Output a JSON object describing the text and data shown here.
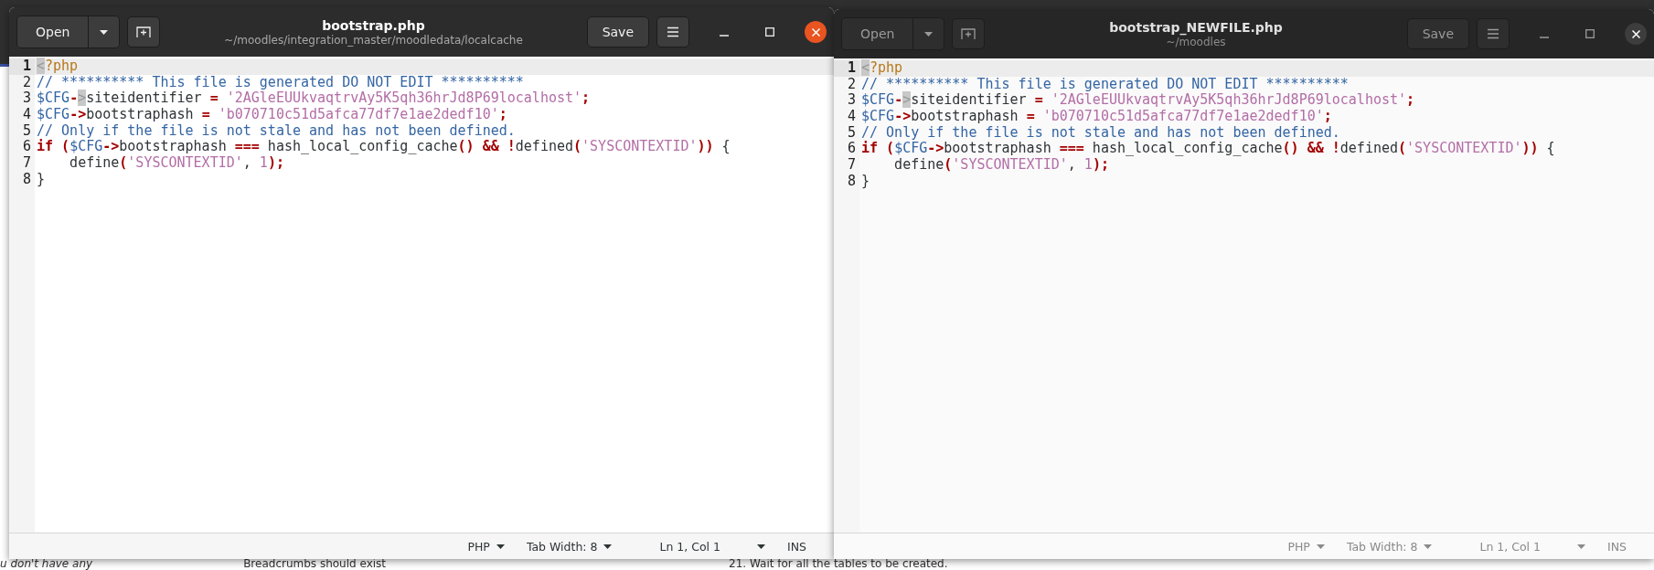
{
  "background_page": {
    "bottom_texts": [
      "u don't have any",
      "Breadcrumbs should exist",
      "21. Wait for all the tables to be created."
    ]
  },
  "windows": [
    {
      "focused": true,
      "title": "bootstrap.php",
      "subtitle": "~/moodles/integration_master/moodledata/localcache",
      "open_label": "Open",
      "save_label": "Save",
      "lines": [
        {
          "number": "1",
          "current": true,
          "tokens": [
            {
              "kind": "match",
              "text": "<"
            },
            {
              "kind": "tag",
              "text": "?php"
            }
          ]
        },
        {
          "number": "2",
          "current": false,
          "tokens": [
            {
              "kind": "comment",
              "text": "// ********** This file is generated DO NOT EDIT **********"
            }
          ]
        },
        {
          "number": "3",
          "current": false,
          "tokens": [
            {
              "kind": "variable",
              "text": "$CFG"
            },
            {
              "kind": "operator",
              "text": "-"
            },
            {
              "kind": "match",
              "text": ">"
            },
            {
              "kind": "plain",
              "text": "siteidentifier "
            },
            {
              "kind": "operator",
              "text": "="
            },
            {
              "kind": "string",
              "text": " '2AGleEUUkvaqtrvAy5K5qh36hrJd8P69localhost'"
            },
            {
              "kind": "operator",
              "text": ";"
            }
          ]
        },
        {
          "number": "4",
          "current": false,
          "tokens": [
            {
              "kind": "variable",
              "text": "$CFG"
            },
            {
              "kind": "operator",
              "text": "->"
            },
            {
              "kind": "plain",
              "text": "bootstraphash "
            },
            {
              "kind": "operator",
              "text": "="
            },
            {
              "kind": "string",
              "text": " 'b070710c51d5afca77df7e1ae2dedf10'"
            },
            {
              "kind": "operator",
              "text": ";"
            }
          ]
        },
        {
          "number": "5",
          "current": false,
          "tokens": [
            {
              "kind": "comment",
              "text": "// Only if the file is not stale and has not been defined."
            }
          ]
        },
        {
          "number": "6",
          "current": false,
          "tokens": [
            {
              "kind": "keyword",
              "text": "if"
            },
            {
              "kind": "operator",
              "text": " ("
            },
            {
              "kind": "variable",
              "text": "$CFG"
            },
            {
              "kind": "operator",
              "text": "->"
            },
            {
              "kind": "plain",
              "text": "bootstraphash "
            },
            {
              "kind": "operator",
              "text": "==="
            },
            {
              "kind": "plain",
              "text": " hash_local_config_cache"
            },
            {
              "kind": "operator",
              "text": "()"
            },
            {
              "kind": "operator",
              "text": " &&"
            },
            {
              "kind": "operator",
              "text": " !"
            },
            {
              "kind": "plain",
              "text": "defined"
            },
            {
              "kind": "operator",
              "text": "("
            },
            {
              "kind": "string",
              "text": "'SYSCONTEXTID'"
            },
            {
              "kind": "operator",
              "text": "))"
            },
            {
              "kind": "plain",
              "text": " {"
            }
          ]
        },
        {
          "number": "7",
          "current": false,
          "tokens": [
            {
              "kind": "plain",
              "text": "    define"
            },
            {
              "kind": "operator",
              "text": "("
            },
            {
              "kind": "string",
              "text": "'SYSCONTEXTID'"
            },
            {
              "kind": "plain",
              "text": ", "
            },
            {
              "kind": "string",
              "text": "1"
            },
            {
              "kind": "operator",
              "text": ");"
            }
          ]
        },
        {
          "number": "8",
          "current": false,
          "tokens": [
            {
              "kind": "plain",
              "text": "}"
            }
          ]
        }
      ],
      "status": {
        "language": "PHP",
        "tab_width": "Tab Width: 8",
        "position": "Ln 1, Col 1",
        "mode": "INS"
      }
    },
    {
      "focused": false,
      "title": "bootstrap_NEWFILE.php",
      "subtitle": "~/moodles",
      "open_label": "Open",
      "save_label": "Save",
      "lines": [
        {
          "number": "1",
          "current": true,
          "tokens": [
            {
              "kind": "match",
              "text": "<"
            },
            {
              "kind": "tag",
              "text": "?php"
            }
          ]
        },
        {
          "number": "2",
          "current": false,
          "tokens": [
            {
              "kind": "comment",
              "text": "// ********** This file is generated DO NOT EDIT **********"
            }
          ]
        },
        {
          "number": "3",
          "current": false,
          "tokens": [
            {
              "kind": "variable",
              "text": "$CFG"
            },
            {
              "kind": "operator",
              "text": "-"
            },
            {
              "kind": "match",
              "text": ">"
            },
            {
              "kind": "plain",
              "text": "siteidentifier "
            },
            {
              "kind": "operator",
              "text": "="
            },
            {
              "kind": "string",
              "text": " '2AGleEUUkvaqtrvAy5K5qh36hrJd8P69localhost'"
            },
            {
              "kind": "operator",
              "text": ";"
            }
          ]
        },
        {
          "number": "4",
          "current": false,
          "tokens": [
            {
              "kind": "variable",
              "text": "$CFG"
            },
            {
              "kind": "operator",
              "text": "->"
            },
            {
              "kind": "plain",
              "text": "bootstraphash "
            },
            {
              "kind": "operator",
              "text": "="
            },
            {
              "kind": "string",
              "text": " 'b070710c51d5afca77df7e1ae2dedf10'"
            },
            {
              "kind": "operator",
              "text": ";"
            }
          ]
        },
        {
          "number": "5",
          "current": false,
          "tokens": [
            {
              "kind": "comment",
              "text": "// Only if the file is not stale and has not been defined."
            }
          ]
        },
        {
          "number": "6",
          "current": false,
          "tokens": [
            {
              "kind": "keyword",
              "text": "if"
            },
            {
              "kind": "operator",
              "text": " ("
            },
            {
              "kind": "variable",
              "text": "$CFG"
            },
            {
              "kind": "operator",
              "text": "->"
            },
            {
              "kind": "plain",
              "text": "bootstraphash "
            },
            {
              "kind": "operator",
              "text": "==="
            },
            {
              "kind": "plain",
              "text": " hash_local_config_cache"
            },
            {
              "kind": "operator",
              "text": "()"
            },
            {
              "kind": "operator",
              "text": " &&"
            },
            {
              "kind": "operator",
              "text": " !"
            },
            {
              "kind": "plain",
              "text": "defined"
            },
            {
              "kind": "operator",
              "text": "("
            },
            {
              "kind": "string",
              "text": "'SYSCONTEXTID'"
            },
            {
              "kind": "operator",
              "text": "))"
            },
            {
              "kind": "plain",
              "text": " {"
            }
          ]
        },
        {
          "number": "7",
          "current": false,
          "tokens": [
            {
              "kind": "plain",
              "text": "    define"
            },
            {
              "kind": "operator",
              "text": "("
            },
            {
              "kind": "string",
              "text": "'SYSCONTEXTID'"
            },
            {
              "kind": "plain",
              "text": ", "
            },
            {
              "kind": "string",
              "text": "1"
            },
            {
              "kind": "operator",
              "text": ");"
            }
          ]
        },
        {
          "number": "8",
          "current": false,
          "tokens": [
            {
              "kind": "plain",
              "text": "}"
            }
          ]
        }
      ],
      "status": {
        "language": "PHP",
        "tab_width": "Tab Width: 8",
        "position": "Ln 1, Col 1",
        "mode": "INS"
      }
    }
  ]
}
